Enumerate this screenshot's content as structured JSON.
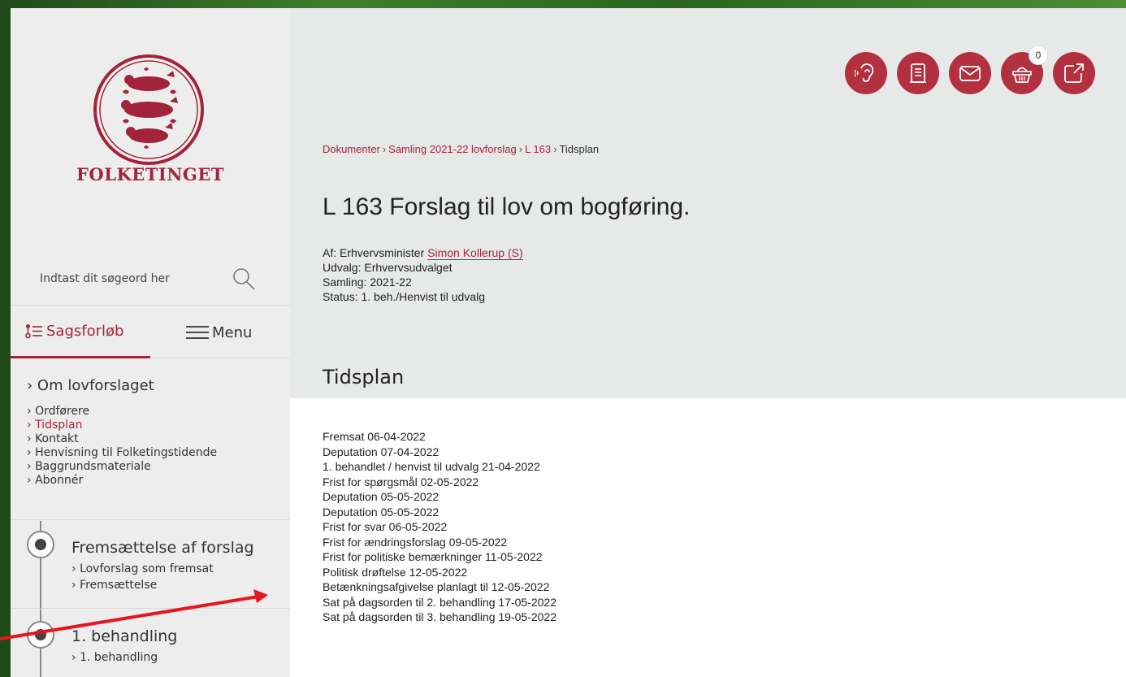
{
  "brand": {
    "name": "FOLKETINGET",
    "accent": "#a3243a"
  },
  "search": {
    "placeholder": "Indtast dit søgeord her"
  },
  "tabs": {
    "sagsforloeb": "Sagsforløb",
    "menu": "Menu"
  },
  "subnav": {
    "title": "Om lovforslaget",
    "items": [
      {
        "label": "Ordførere"
      },
      {
        "label": "Tidsplan"
      },
      {
        "label": "Kontakt"
      },
      {
        "label": "Henvisning til Folketingstidende"
      },
      {
        "label": "Baggrundsmateriale"
      },
      {
        "label": "Abonnér"
      }
    ]
  },
  "timeline": [
    {
      "title": "Fremsættelse af forslag",
      "links": [
        "Lovforslag som fremsat",
        "Fremsættelse"
      ]
    },
    {
      "title": "1. behandling",
      "links": [
        "1. behandling"
      ]
    }
  ],
  "top_icons": {
    "listen": "ear-icon",
    "print": "document-icon",
    "email": "envelope-icon",
    "basket": "basket-icon",
    "basket_count": "0",
    "share": "external-link-icon"
  },
  "breadcrumb": [
    "Dokumenter",
    "Samling 2021-22 lovforslag",
    "L 163",
    "Tidsplan"
  ],
  "page": {
    "title": "L 163 Forslag til lov om bogføring.",
    "meta": {
      "af_label": "Af: Erhvervsminister",
      "af_person": "Simon Kollerup (S)",
      "udvalg": "Udvalg: Erhvervsudvalget",
      "samling": "Samling: 2021-22",
      "status": "Status: 1. beh./Henvist til udvalg"
    },
    "section_title": "Tidsplan",
    "schedule": [
      "Fremsat 06-04-2022",
      "Deputation 07-04-2022",
      "1. behandlet / henvist til udvalg 21-04-2022",
      "Frist for spørgsmål 02-05-2022",
      "Deputation 05-05-2022",
      "Deputation 05-05-2022",
      "Frist for svar 06-05-2022",
      "Frist for ændringsforslag 09-05-2022",
      "Frist for politiske bemærkninger 11-05-2022",
      "Politisk drøftelse 12-05-2022",
      "Betænkningsafgivelse planlagt til 12-05-2022",
      "Sat på dagsorden til 2. behandling 17-05-2022",
      "Sat på dagsorden til 3. behandling 19-05-2022"
    ]
  }
}
